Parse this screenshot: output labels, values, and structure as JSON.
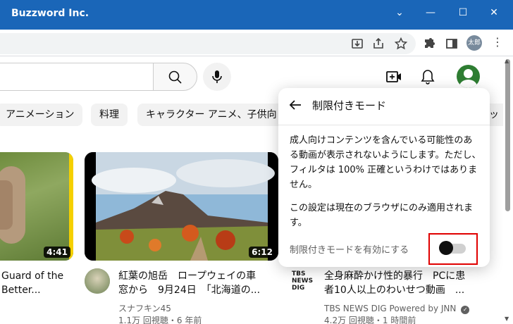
{
  "window": {
    "title": "Buzzword Inc."
  },
  "browser": {
    "profile_label": "太郎"
  },
  "chips": [
    "アニメーション",
    "料理",
    "キャラクター アニメ、子供向",
    "ッ"
  ],
  "videos": [
    {
      "title_lines": [
        "Guard of the",
        "Better..."
      ],
      "duration": "4:41"
    },
    {
      "title_lines": [
        "紅葉の旭岳　ロープウェイの車",
        "窓から　9月24日　「北海道の..."
      ],
      "duration": "6:12",
      "channel": "スナフキン45",
      "meta": "1.1万 回視聴・6 年前"
    },
    {
      "title_lines": [
        "全身麻酔かけ性的暴行　PCに患",
        "者10人以上のわいせつ動画　..."
      ],
      "channel": "TBS NEWS DIG Powered by JNN",
      "meta": "4.2万 回視聴・1 時間前",
      "logo_lines": [
        "TBS",
        "NEWS",
        "DIG"
      ]
    }
  ],
  "popup": {
    "title": "制限付きモード",
    "description": "成人向けコンテンツを含んでいる可能性のある動画が表示されないようにします。ただし、フィルタは 100% 正確というわけではありません。",
    "note": "この設定は現在のブラウザにのみ適用されます。",
    "toggle_label": "制限付きモードを有効にする",
    "toggle_on": false,
    "highlight_color": "#e00000"
  },
  "colors": {
    "titlebar": "#1a66b8",
    "accent_avatar": "#2e7d32"
  }
}
